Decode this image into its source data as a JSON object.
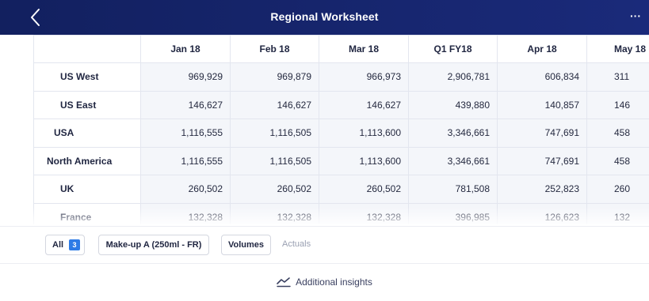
{
  "header": {
    "title": "Regional Worksheet",
    "more_label": "···"
  },
  "table": {
    "columns": [
      "Jan 18",
      "Feb 18",
      "Mar 18",
      "Q1 FY18",
      "Apr 18",
      "May 18"
    ],
    "rows": [
      {
        "label": "US West",
        "values": [
          "969,929",
          "969,879",
          "966,973",
          "2,906,781",
          "606,834",
          "311"
        ]
      },
      {
        "label": "US East",
        "values": [
          "146,627",
          "146,627",
          "146,627",
          "439,880",
          "140,857",
          "146"
        ]
      },
      {
        "label": "USA",
        "values": [
          "1,116,555",
          "1,116,505",
          "1,113,600",
          "3,346,661",
          "747,691",
          "458"
        ]
      },
      {
        "label": "North America",
        "values": [
          "1,116,555",
          "1,116,505",
          "1,113,600",
          "3,346,661",
          "747,691",
          "458"
        ]
      },
      {
        "label": "UK",
        "values": [
          "260,502",
          "260,502",
          "260,502",
          "781,508",
          "252,823",
          "260"
        ]
      },
      {
        "label": "France",
        "values": [
          "132,328",
          "132,328",
          "132,328",
          "396,985",
          "126,623",
          "132"
        ]
      }
    ]
  },
  "filters": {
    "all_label": "All",
    "all_count": "3",
    "product_label": "Make-up A (250ml - FR)",
    "volumes_label": "Volumes",
    "actuals_label": "Actuals"
  },
  "insights": {
    "label": "Additional insights"
  },
  "colors": {
    "header_bg": "#12205f",
    "badge": "#2d7be6",
    "cell_bg": "#f4f6fa"
  }
}
